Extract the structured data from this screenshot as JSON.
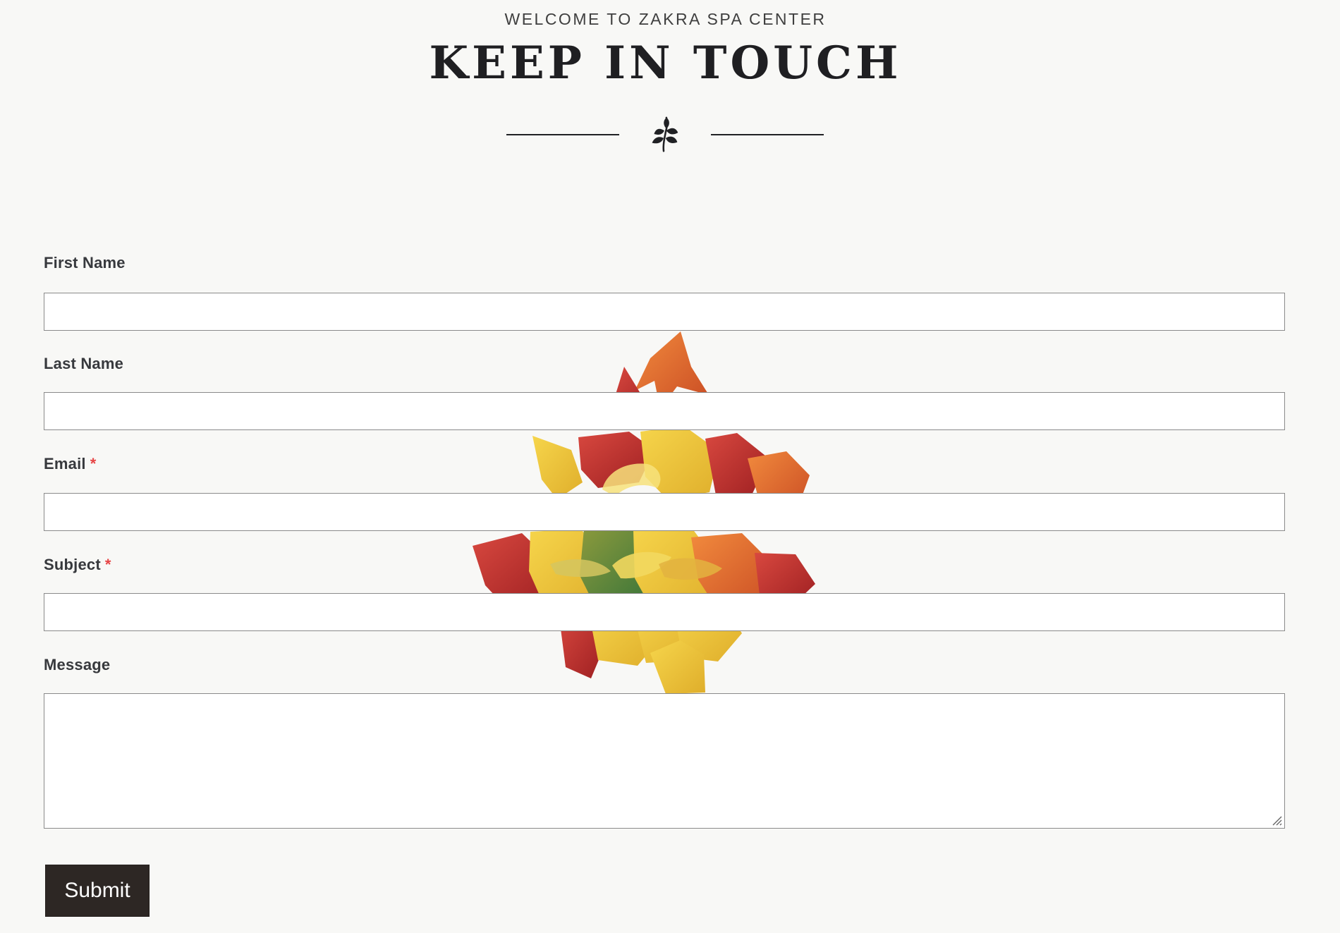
{
  "header": {
    "eyebrow": "WELCOME TO ZAKRA SPA CENTER",
    "title": "KEEP IN TOUCH",
    "icon": "leaf-icon"
  },
  "form": {
    "fields": [
      {
        "label": "First Name",
        "required": false,
        "type": "text",
        "value": ""
      },
      {
        "label": "Last Name",
        "required": false,
        "type": "text",
        "value": ""
      },
      {
        "label": "Email",
        "required": true,
        "type": "email",
        "value": ""
      },
      {
        "label": "Subject",
        "required": true,
        "type": "text",
        "value": ""
      },
      {
        "label": "Message",
        "required": false,
        "type": "textarea",
        "value": ""
      }
    ],
    "required_marker": "*",
    "submit_label": "Submit"
  },
  "colors": {
    "background": "#f8f8f6",
    "heading": "#1f1f22",
    "label": "#37393d",
    "required": "#e64545",
    "button": "#2d2724",
    "button_text": "#ffffff"
  }
}
